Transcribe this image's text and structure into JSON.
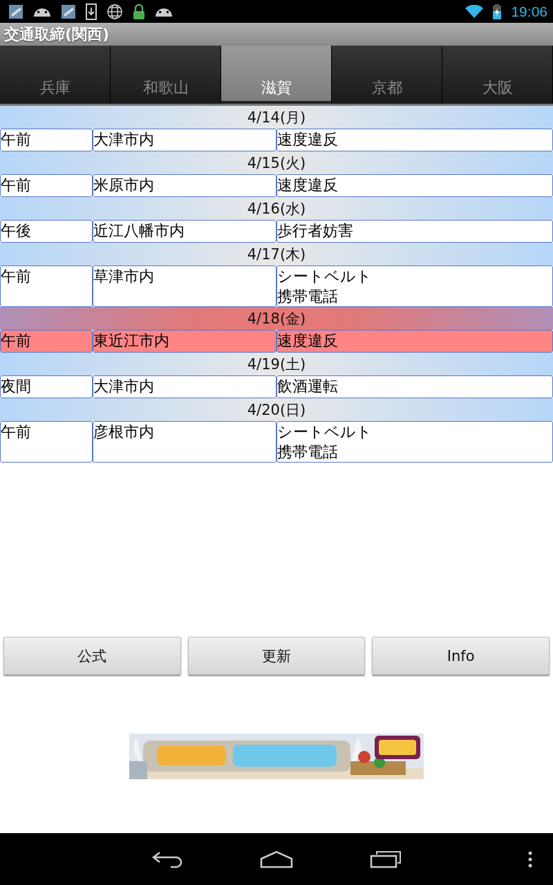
{
  "status_bar": {
    "time": "19:06"
  },
  "app_title": "交通取締(関西)",
  "tabs": [
    {
      "label": "兵庫",
      "selected": false
    },
    {
      "label": "和歌山",
      "selected": false
    },
    {
      "label": "滋賀",
      "selected": true
    },
    {
      "label": "京都",
      "selected": false
    },
    {
      "label": "大阪",
      "selected": false
    }
  ],
  "days": [
    {
      "date": "4/14(月)",
      "highlighted": false,
      "time": "午前",
      "place": "大津市内",
      "violations": [
        "速度違反"
      ]
    },
    {
      "date": "4/15(火)",
      "highlighted": false,
      "time": "午前",
      "place": "米原市内",
      "violations": [
        "速度違反"
      ]
    },
    {
      "date": "4/16(水)",
      "highlighted": false,
      "time": "午後",
      "place": "近江八幡市内",
      "violations": [
        "歩行者妨害"
      ]
    },
    {
      "date": "4/17(木)",
      "highlighted": false,
      "time": "午前",
      "place": "草津市内",
      "violations": [
        "シートベルト",
        "携帯電話"
      ]
    },
    {
      "date": "4/18(金)",
      "highlighted": true,
      "time": "午前",
      "place": "東近江市内",
      "violations": [
        "速度違反"
      ]
    },
    {
      "date": "4/19(土)",
      "highlighted": false,
      "time": "夜間",
      "place": "大津市内",
      "violations": [
        "飲酒運転"
      ]
    },
    {
      "date": "4/20(日)",
      "highlighted": false,
      "time": "午前",
      "place": "彦根市内",
      "violations": [
        "シートベルト",
        "携帯電話"
      ]
    }
  ],
  "buttons": [
    "公式",
    "更新",
    "Info"
  ]
}
